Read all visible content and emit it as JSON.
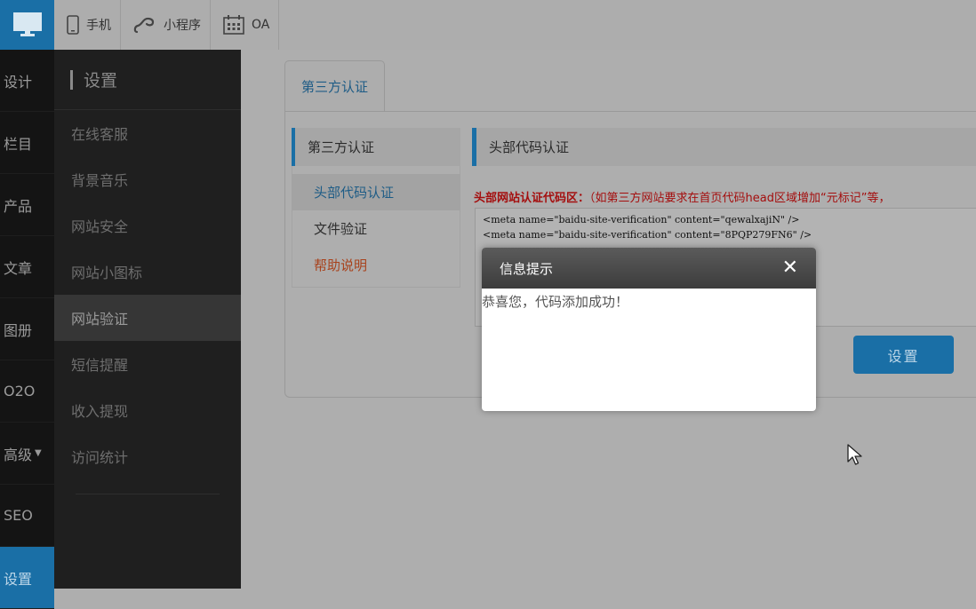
{
  "topbar": {
    "items": [
      {
        "label": "手机",
        "icon": "phone-icon"
      },
      {
        "label": "小程序",
        "icon": "mini-program-icon"
      },
      {
        "label": "OA",
        "icon": "calendar-icon"
      }
    ]
  },
  "rail": {
    "items": [
      {
        "label": "设计"
      },
      {
        "label": "栏目"
      },
      {
        "label": "产品"
      },
      {
        "label": "文章"
      },
      {
        "label": "图册"
      },
      {
        "label": "O2O"
      },
      {
        "label": "高级"
      },
      {
        "label": "SEO"
      },
      {
        "label": "设置"
      }
    ]
  },
  "sidebar": {
    "title": "设置",
    "items": [
      {
        "label": "在线客服"
      },
      {
        "label": "背景音乐"
      },
      {
        "label": "网站安全"
      },
      {
        "label": "网站小图标"
      },
      {
        "label": "网站验证"
      },
      {
        "label": "短信提醒"
      },
      {
        "label": "收入提现"
      },
      {
        "label": "访问统计"
      }
    ]
  },
  "main": {
    "tab": "第三方认证",
    "subnav": {
      "title": "第三方认证",
      "items": [
        {
          "label": "头部代码认证"
        },
        {
          "label": "文件验证"
        },
        {
          "label": "帮助说明"
        }
      ]
    },
    "section_title": "头部代码认证",
    "code_label_bold": "头部网站认证代码区：",
    "code_label_rest": "（如第三方网站要求在首页代码head区域增加“元标记”等，",
    "code_value": "<meta name=\"baidu-site-verification\" content=\"qewalxajiN\" />\n<meta name=\"baidu-site-verification\" content=\"8PQP279FN6\" />",
    "submit_label": "设置"
  },
  "modal": {
    "title": "信息提示",
    "message": "恭喜您，代码添加成功！",
    "close_symbol": "✕"
  },
  "colors": {
    "accent": "#1a6fa6",
    "warning_text": "#a40e0e"
  }
}
